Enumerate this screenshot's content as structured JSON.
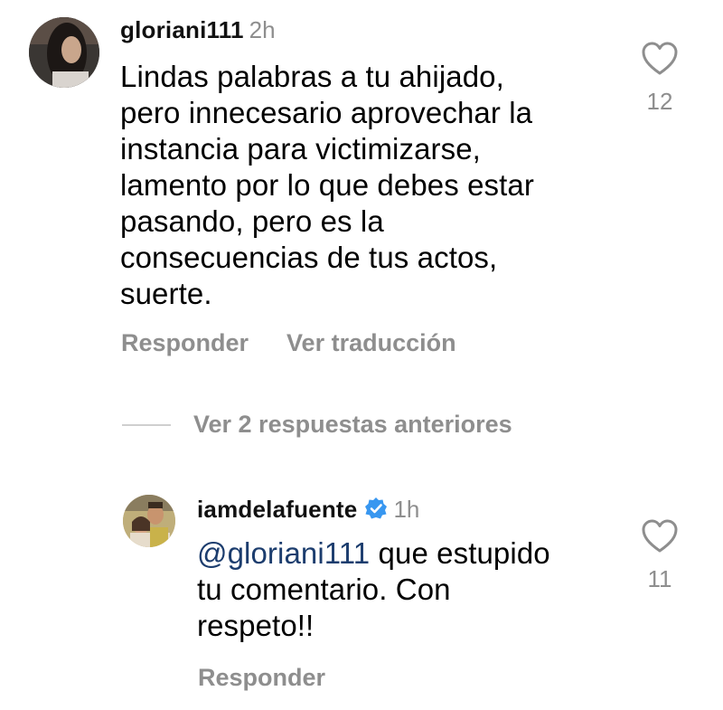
{
  "comment": {
    "username": "gloriani111",
    "time": "2h",
    "text_lines": [
      "Lindas palabras a tu ahijado,",
      "pero innecesario aprovechar la",
      "instancia para victimizarse,",
      "lamento por lo que debes estar",
      "pasando, pero es la",
      "consecuencias de tus actos,",
      "suerte."
    ],
    "likes": "12",
    "reply_label": "Responder",
    "translate_label": "Ver traducción"
  },
  "replies_toggle": {
    "label": "Ver 2 respuestas anteriores"
  },
  "reply": {
    "username": "iamdelafuente",
    "verified_icon": "verified-badge-icon",
    "time": "1h",
    "mention": "@gloriani111",
    "text_first": " que estupido",
    "text_lines": [
      "tu comentario. Con",
      "respeto!!"
    ],
    "likes": "11",
    "reply_label": "Responder"
  },
  "colors": {
    "secondary_text": "#8e8e8e",
    "mention": "#1c3d6e",
    "verified": "#3897f0",
    "heart_stroke": "#8e8e8e"
  }
}
